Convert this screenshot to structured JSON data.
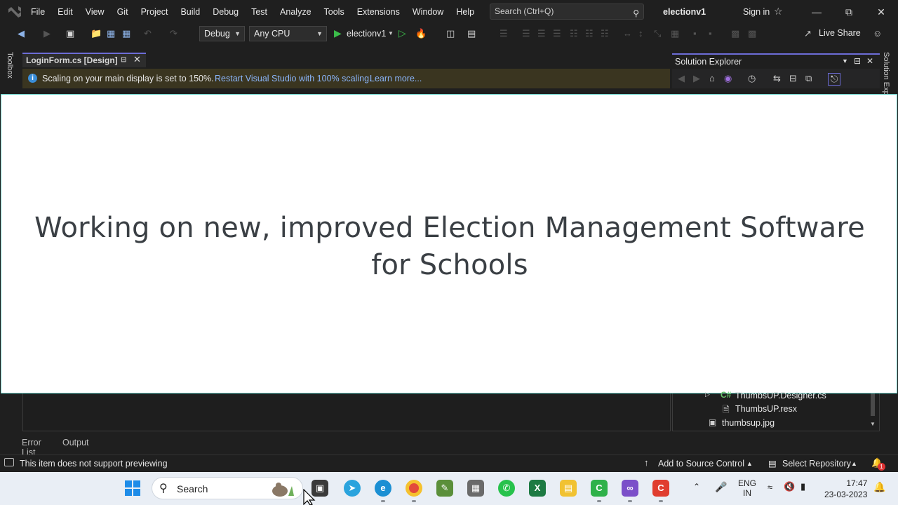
{
  "menubar": {
    "items": [
      "File",
      "Edit",
      "View",
      "Git",
      "Project",
      "Build",
      "Debug",
      "Test",
      "Analyze",
      "Tools",
      "Extensions",
      "Window",
      "Help"
    ],
    "search_placeholder": "Search (Ctrl+Q)",
    "solution_name": "electionv1",
    "sign_in": "Sign in"
  },
  "toolbar": {
    "config": "Debug",
    "platform": "Any CPU",
    "start_target": "electionv1",
    "live_share": "Live Share"
  },
  "rails": {
    "left": "Toolbox",
    "right": "Solution Explorer"
  },
  "document_tab": {
    "label": "LoginForm.cs [Design]"
  },
  "infobar": {
    "message": "Scaling on your main display is set to 150%.",
    "link_restart": "Restart Visual Studio with 100% scaling.",
    "link_learn": "Learn more..."
  },
  "solution_explorer": {
    "title": "Solution Explorer",
    "tree": [
      {
        "label": "ThumbsUP.Designer.cs",
        "icon": "csharp-file-icon"
      },
      {
        "label": "ThumbsUP.resx",
        "icon": "resx-file-icon"
      },
      {
        "label": "thumbsup.jpg",
        "icon": "image-file-icon"
      }
    ]
  },
  "overlay": {
    "headline_line1": "Working on new, improved Election Management Software",
    "headline_line2": "for Schools"
  },
  "bottom_tabs": [
    "Error List",
    "Output"
  ],
  "statusbar": {
    "message": "This item does not support previewing",
    "add_source_control": "Add to Source Control",
    "select_repository": "Select Repository",
    "notification_count": "1"
  },
  "taskbar": {
    "search_label": "Search",
    "language_line1": "ENG",
    "language_line2": "IN",
    "time": "17:47",
    "date": "23-03-2023"
  },
  "colors": {
    "accent_purple": "#6c6cd6",
    "overlay_border": "#6ad1c9",
    "headline_text": "#3a3f44",
    "link": "#8ab4f8",
    "infobar_bg": "#3a3520"
  }
}
